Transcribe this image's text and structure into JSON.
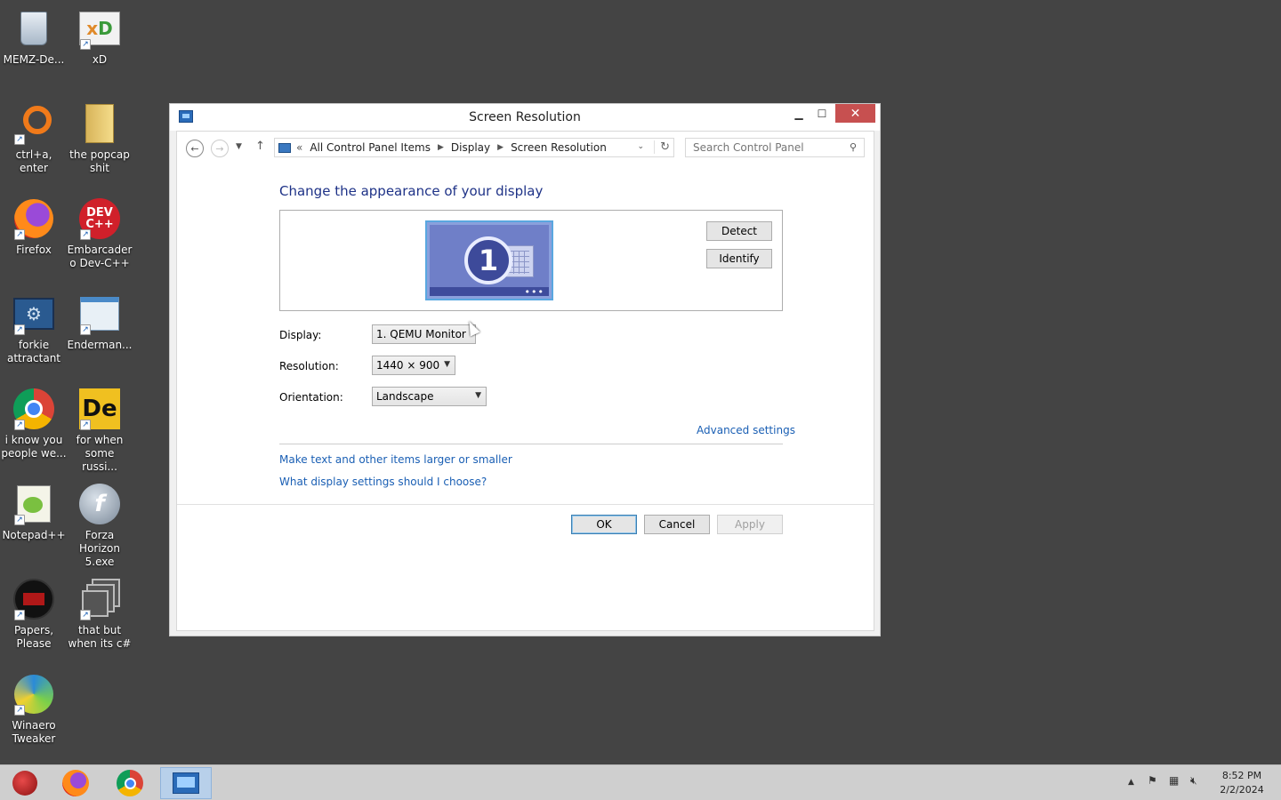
{
  "desktop": {
    "icons": [
      {
        "label": "MEMZ-De...",
        "icon": "recycle-bin-icon"
      },
      {
        "label": "xD",
        "icon": "xd-app-icon"
      },
      {
        "label": "ctrl+a, enter",
        "icon": "magnifier-ring-icon"
      },
      {
        "label": "the popcap shit",
        "icon": "folder-icon"
      },
      {
        "label": "Firefox",
        "icon": "firefox-icon"
      },
      {
        "label": "Embarcadero Dev-C++",
        "icon": "devcpp-icon"
      },
      {
        "label": "forkie attractant",
        "icon": "settings-monitor-icon"
      },
      {
        "label": "Enderman...",
        "icon": "window-app-icon"
      },
      {
        "label": "i know you people we...",
        "icon": "chrome-icon"
      },
      {
        "label": "for when some russi...",
        "icon": "de-app-icon"
      },
      {
        "label": "Notepad++",
        "icon": "notepadpp-icon"
      },
      {
        "label": "Forza Horizon 5.exe",
        "icon": "flash-icon"
      },
      {
        "label": "Papers, Please",
        "icon": "papers-please-icon"
      },
      {
        "label": "that but when its c#",
        "icon": "stacked-windows-icon"
      },
      {
        "label": "Winaero Tweaker",
        "icon": "winaero-icon"
      }
    ]
  },
  "window": {
    "title": "Screen Resolution",
    "breadcrumb": {
      "prefix": "«",
      "items": [
        "All Control Panel Items",
        "Display",
        "Screen Resolution"
      ]
    },
    "search_placeholder": "Search Control Panel",
    "heading": "Change the appearance of your display",
    "monitor_number": "1",
    "buttons": {
      "detect": "Detect",
      "identify": "Identify",
      "ok": "OK",
      "cancel": "Cancel",
      "apply": "Apply"
    },
    "fields": {
      "display": {
        "label": "Display:",
        "value": "1. QEMU Monitor"
      },
      "resolution": {
        "label": "Resolution:",
        "value": "1440 × 900"
      },
      "orientation": {
        "label": "Orientation:",
        "value": "Landscape"
      }
    },
    "links": {
      "advanced": "Advanced settings",
      "text_size": "Make text and other items larger or smaller",
      "help": "What display settings should I choose?"
    }
  },
  "taskbar": {
    "clock_time": "8:52 PM",
    "clock_date": "2/2/2024"
  },
  "colors": {
    "desktop": "#444444",
    "link": "#1a5fb4",
    "heading": "#1e3287",
    "close": "#c75050"
  }
}
